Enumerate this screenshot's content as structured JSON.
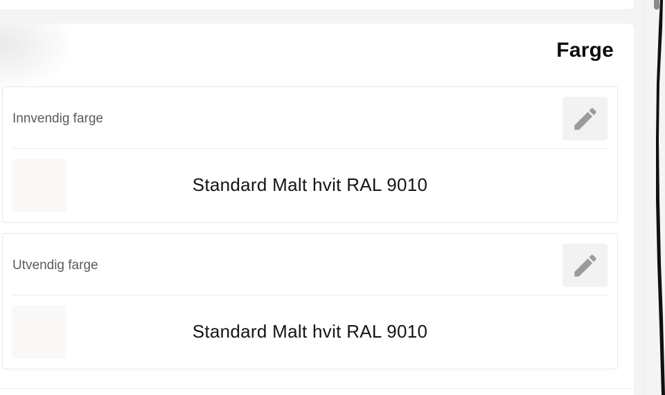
{
  "section": {
    "title": "Farge"
  },
  "interior": {
    "label": "Innvendig farge",
    "color_name": "Standard Malt hvit RAL 9010",
    "swatch_color": "#faf8f6",
    "edit_icon": "pencil-icon"
  },
  "exterior": {
    "label": "Utvendig farge",
    "color_name": "Standard Malt hvit RAL 9010",
    "swatch_color": "#faf8f6",
    "edit_icon": "pencil-icon"
  },
  "colors": {
    "page_bg": "#f4f4f4",
    "card_bg": "#ffffff",
    "icon": "#9b9b9b",
    "edit_button_bg": "#f2f2f2"
  }
}
